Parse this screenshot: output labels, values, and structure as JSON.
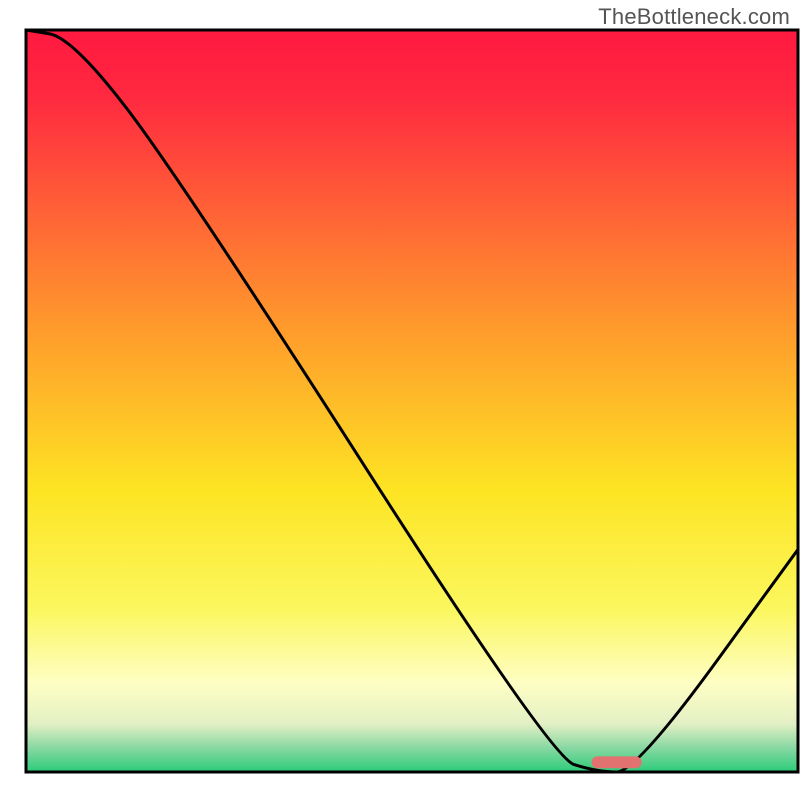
{
  "watermark": "TheBottleneck.com",
  "chart_data": {
    "type": "line",
    "title": "",
    "xlabel": "",
    "ylabel": "",
    "xlim": [
      0,
      100
    ],
    "ylim": [
      0,
      100
    ],
    "series": [
      {
        "name": "bottleneck-curve",
        "x": [
          0,
          6,
          20,
          68,
          74,
          79,
          100
        ],
        "y": [
          100,
          99,
          80,
          2,
          0,
          0,
          30
        ]
      }
    ],
    "marker": {
      "x": 76.5,
      "y": 1.3,
      "width": 6.5,
      "height": 1.6,
      "color": "#e2726f"
    },
    "background_gradient_stops": [
      {
        "offset": 0.0,
        "color": "#ff1940"
      },
      {
        "offset": 0.09,
        "color": "#ff2940"
      },
      {
        "offset": 0.4,
        "color": "#ff9a2c"
      },
      {
        "offset": 0.62,
        "color": "#fde423"
      },
      {
        "offset": 0.78,
        "color": "#fbf75e"
      },
      {
        "offset": 0.88,
        "color": "#fefec4"
      },
      {
        "offset": 0.935,
        "color": "#e3f0c4"
      },
      {
        "offset": 0.965,
        "color": "#8fd9a5"
      },
      {
        "offset": 1.0,
        "color": "#2bcc7a"
      }
    ],
    "frame": {
      "stroke": "#000000",
      "stroke_width": 3
    }
  }
}
